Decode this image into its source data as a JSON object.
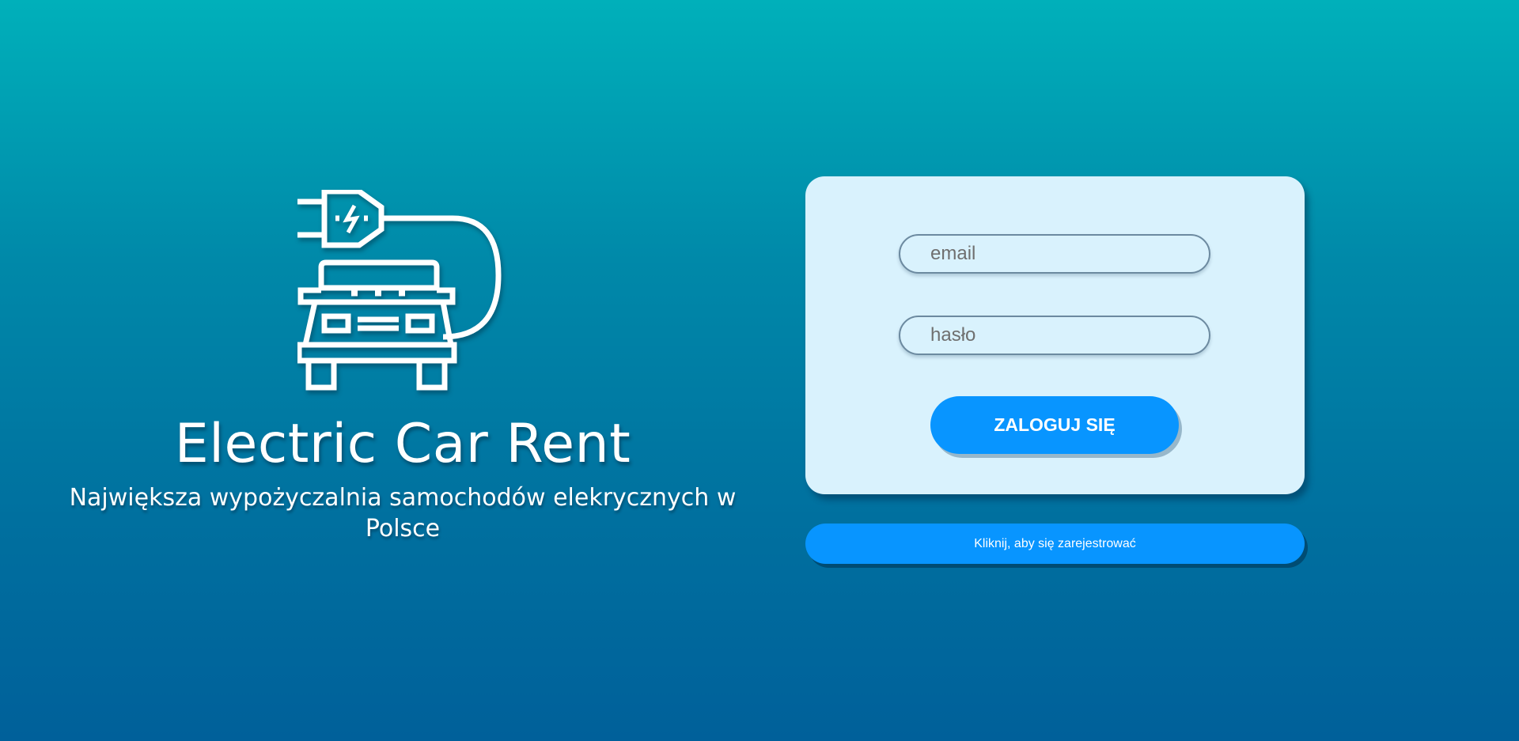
{
  "hero": {
    "title": "Electric Car Rent",
    "subtitle": "Największa wypożyczalnia samochodów elekrycznych w Polsce",
    "icon": "electric-car-plug-icon"
  },
  "login": {
    "email_placeholder": "email",
    "password_placeholder": "hasło",
    "submit_label": "ZALOGUJ SIĘ"
  },
  "register": {
    "label": "Kliknij, aby się zarejestrować"
  },
  "colors": {
    "background_top": "#00b0ba",
    "background_bottom": "#00609a",
    "card": "#d9f2fd",
    "button": "#0895ff",
    "text_light": "#ffffff"
  }
}
